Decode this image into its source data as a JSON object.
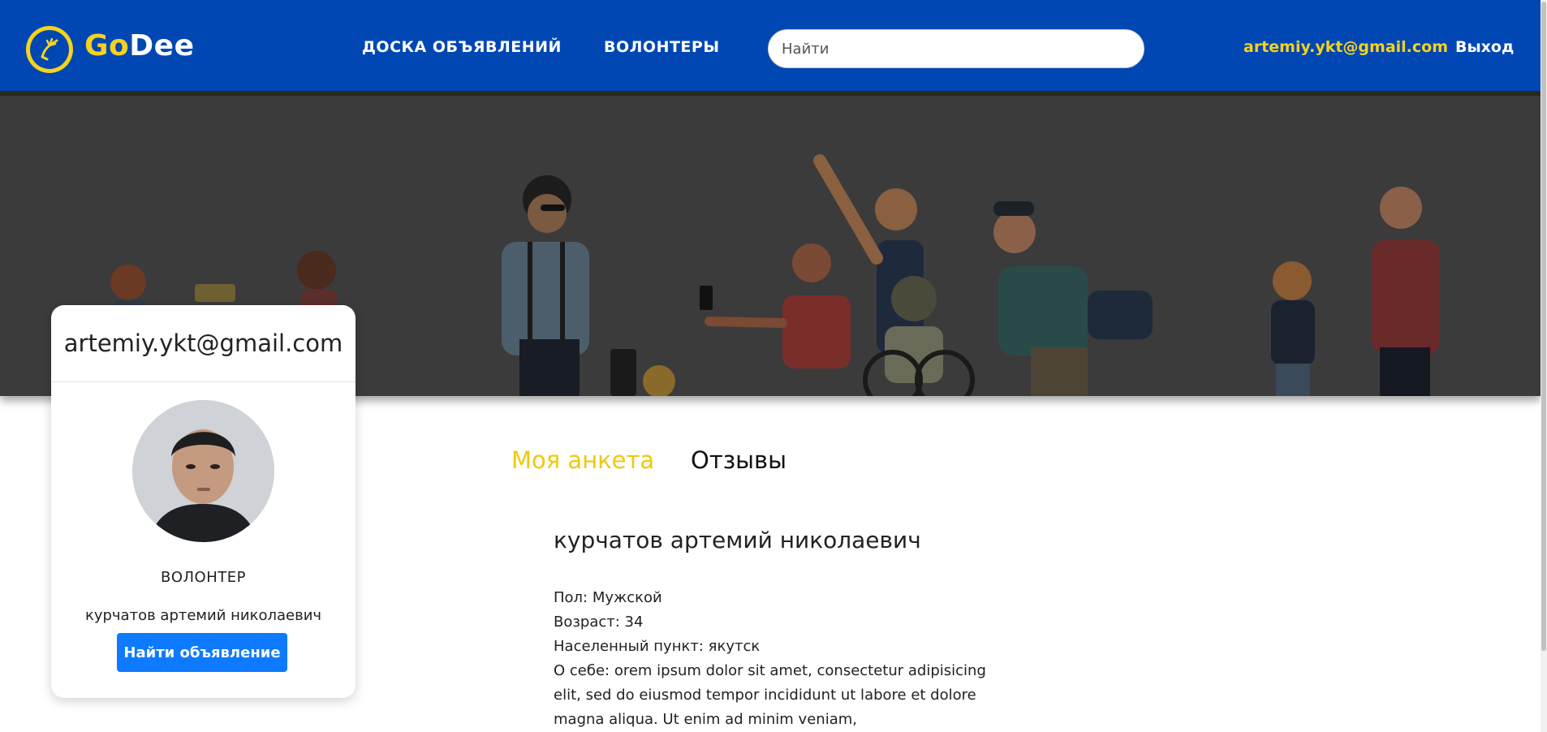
{
  "header": {
    "logo_go": "Go",
    "logo_dee": "Dee",
    "nav": [
      {
        "label": "ДОСКА ОБЪЯВЛЕНИЙ"
      },
      {
        "label": "ВОЛОНТЕРЫ"
      }
    ],
    "search_placeholder": "Найти",
    "user_email": "artemiy.ykt@gmail.com",
    "logout_label": "Выход"
  },
  "colors": {
    "header_bg": "#0047b3",
    "accent_yellow": "#f4d21f",
    "button_blue": "#0d7aff",
    "banner_bg": "#3b3b3b"
  },
  "card": {
    "email": "artemiy.ykt@gmail.com",
    "role": "ВОЛОНТЕР",
    "name": "курчатов артемий николаевич",
    "button_label": "Найти объявление"
  },
  "tabs": [
    {
      "label": "Моя анкета",
      "active": true
    },
    {
      "label": "Отзывы",
      "active": false
    }
  ],
  "profile": {
    "full_name": "курчатов артемий николаевич",
    "gender": "Пол: Мужской",
    "age": "Возраст: 34",
    "city": "Населенный пункт: якутск",
    "about": "О себе: orem ipsum dolor sit amet, consectetur adipisicing elit, sed do eiusmod tempor incididunt ut labore et dolore magna aliqua. Ut enim ad minim veniam,"
  }
}
